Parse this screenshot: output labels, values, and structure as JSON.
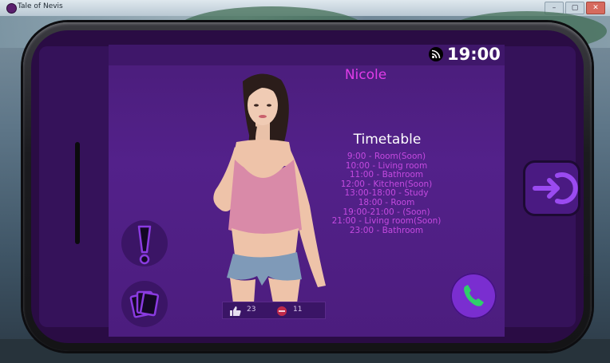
{
  "window": {
    "title": "Tale of Nevis"
  },
  "phone": {
    "time": "19:00",
    "character_name": "Nicole",
    "timetable": {
      "title": "Timetable",
      "entries": [
        "9:00 - Room(Soon)",
        "10:00 - Living room",
        "11:00 - Bathroom",
        "12:00 - Kitchen(Soon)",
        "13:00-18:00 - Study",
        "18:00 - Room",
        "19:00-21:00 - (Soon)",
        "21:00 - Living room(Soon)",
        "23:00 - Bathroom"
      ]
    },
    "stats": {
      "likes": "23",
      "dislikes": "11"
    }
  },
  "icons": {
    "wifi": "wifi-icon",
    "alert": "exclamation-icon",
    "cards": "cards-icon",
    "call": "phone-call-icon",
    "exit": "exit-icon",
    "like": "thumbs-up-icon",
    "dislike": "dislike-icon"
  },
  "colors": {
    "accent": "#e03ce8",
    "screen": "#4e1e84",
    "call": "#7a2ed0",
    "timetable_text": "#c44ae0"
  }
}
